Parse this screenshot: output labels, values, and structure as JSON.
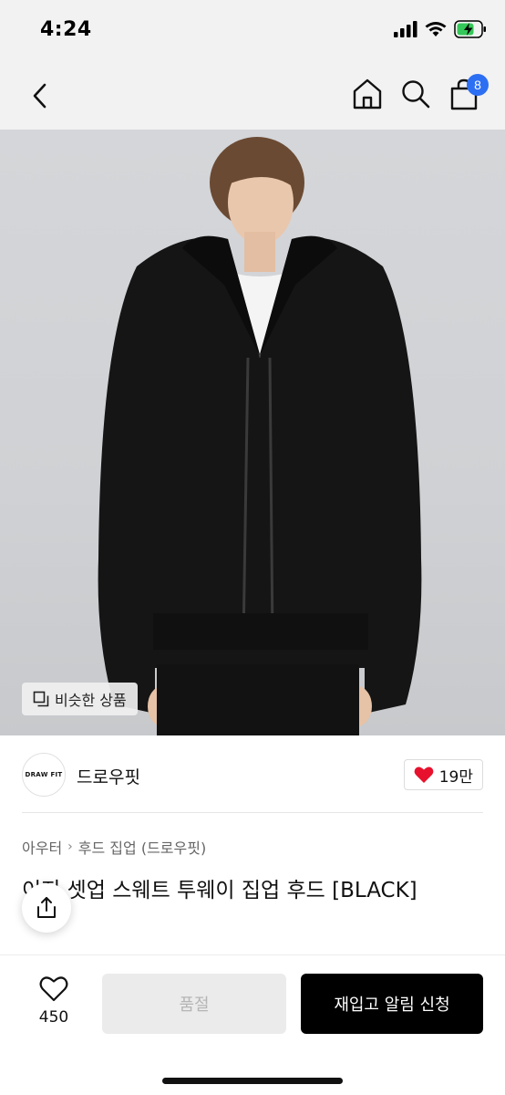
{
  "status": {
    "time": "4:24"
  },
  "nav": {
    "cart_badge": "8"
  },
  "image": {
    "similar_label": "비슷한 상품"
  },
  "brand": {
    "logo_text": "DRAW FIT",
    "name": "드로우핏",
    "likes": "19만"
  },
  "breadcrumb": {
    "items": [
      "아우터",
      "후드 집업 (드로우핏)"
    ]
  },
  "product": {
    "title": "이지 셋업 스웨트 투웨이 집업 후드 [BLACK]"
  },
  "bottom": {
    "like_count": "450",
    "soldout_label": "품절",
    "restock_label": "재입고 알림 신청"
  },
  "colors": {
    "accent_blue": "#2d6ff3",
    "heart_red": "#e8112d",
    "primary_black": "#000000"
  },
  "icons": [
    "back-icon",
    "home-icon",
    "search-icon",
    "shopping-bag-icon",
    "similar-icon",
    "heart-icon",
    "share-icon",
    "heart-outline-icon"
  ]
}
